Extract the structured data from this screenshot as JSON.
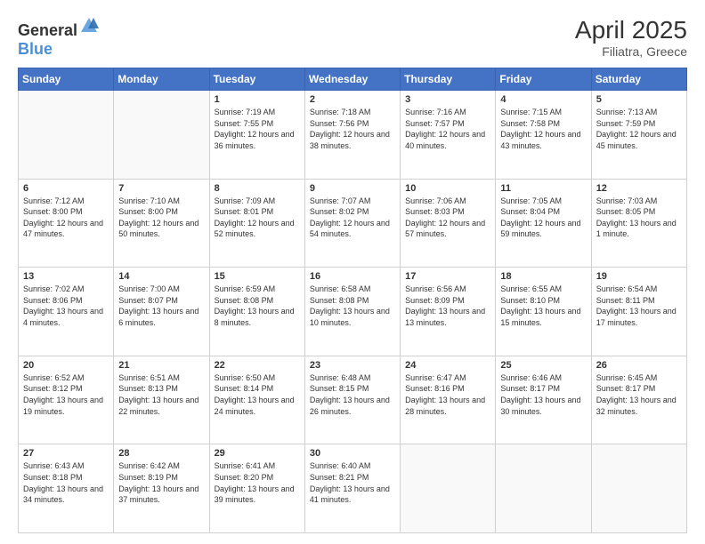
{
  "header": {
    "logo_general": "General",
    "logo_blue": "Blue",
    "title": "April 2025",
    "subtitle": "Filiatra, Greece"
  },
  "weekdays": [
    "Sunday",
    "Monday",
    "Tuesday",
    "Wednesday",
    "Thursday",
    "Friday",
    "Saturday"
  ],
  "weeks": [
    [
      {
        "day": "",
        "info": ""
      },
      {
        "day": "",
        "info": ""
      },
      {
        "day": "1",
        "info": "Sunrise: 7:19 AM\nSunset: 7:55 PM\nDaylight: 12 hours and 36 minutes."
      },
      {
        "day": "2",
        "info": "Sunrise: 7:18 AM\nSunset: 7:56 PM\nDaylight: 12 hours and 38 minutes."
      },
      {
        "day": "3",
        "info": "Sunrise: 7:16 AM\nSunset: 7:57 PM\nDaylight: 12 hours and 40 minutes."
      },
      {
        "day": "4",
        "info": "Sunrise: 7:15 AM\nSunset: 7:58 PM\nDaylight: 12 hours and 43 minutes."
      },
      {
        "day": "5",
        "info": "Sunrise: 7:13 AM\nSunset: 7:59 PM\nDaylight: 12 hours and 45 minutes."
      }
    ],
    [
      {
        "day": "6",
        "info": "Sunrise: 7:12 AM\nSunset: 8:00 PM\nDaylight: 12 hours and 47 minutes."
      },
      {
        "day": "7",
        "info": "Sunrise: 7:10 AM\nSunset: 8:00 PM\nDaylight: 12 hours and 50 minutes."
      },
      {
        "day": "8",
        "info": "Sunrise: 7:09 AM\nSunset: 8:01 PM\nDaylight: 12 hours and 52 minutes."
      },
      {
        "day": "9",
        "info": "Sunrise: 7:07 AM\nSunset: 8:02 PM\nDaylight: 12 hours and 54 minutes."
      },
      {
        "day": "10",
        "info": "Sunrise: 7:06 AM\nSunset: 8:03 PM\nDaylight: 12 hours and 57 minutes."
      },
      {
        "day": "11",
        "info": "Sunrise: 7:05 AM\nSunset: 8:04 PM\nDaylight: 12 hours and 59 minutes."
      },
      {
        "day": "12",
        "info": "Sunrise: 7:03 AM\nSunset: 8:05 PM\nDaylight: 13 hours and 1 minute."
      }
    ],
    [
      {
        "day": "13",
        "info": "Sunrise: 7:02 AM\nSunset: 8:06 PM\nDaylight: 13 hours and 4 minutes."
      },
      {
        "day": "14",
        "info": "Sunrise: 7:00 AM\nSunset: 8:07 PM\nDaylight: 13 hours and 6 minutes."
      },
      {
        "day": "15",
        "info": "Sunrise: 6:59 AM\nSunset: 8:08 PM\nDaylight: 13 hours and 8 minutes."
      },
      {
        "day": "16",
        "info": "Sunrise: 6:58 AM\nSunset: 8:08 PM\nDaylight: 13 hours and 10 minutes."
      },
      {
        "day": "17",
        "info": "Sunrise: 6:56 AM\nSunset: 8:09 PM\nDaylight: 13 hours and 13 minutes."
      },
      {
        "day": "18",
        "info": "Sunrise: 6:55 AM\nSunset: 8:10 PM\nDaylight: 13 hours and 15 minutes."
      },
      {
        "day": "19",
        "info": "Sunrise: 6:54 AM\nSunset: 8:11 PM\nDaylight: 13 hours and 17 minutes."
      }
    ],
    [
      {
        "day": "20",
        "info": "Sunrise: 6:52 AM\nSunset: 8:12 PM\nDaylight: 13 hours and 19 minutes."
      },
      {
        "day": "21",
        "info": "Sunrise: 6:51 AM\nSunset: 8:13 PM\nDaylight: 13 hours and 22 minutes."
      },
      {
        "day": "22",
        "info": "Sunrise: 6:50 AM\nSunset: 8:14 PM\nDaylight: 13 hours and 24 minutes."
      },
      {
        "day": "23",
        "info": "Sunrise: 6:48 AM\nSunset: 8:15 PM\nDaylight: 13 hours and 26 minutes."
      },
      {
        "day": "24",
        "info": "Sunrise: 6:47 AM\nSunset: 8:16 PM\nDaylight: 13 hours and 28 minutes."
      },
      {
        "day": "25",
        "info": "Sunrise: 6:46 AM\nSunset: 8:17 PM\nDaylight: 13 hours and 30 minutes."
      },
      {
        "day": "26",
        "info": "Sunrise: 6:45 AM\nSunset: 8:17 PM\nDaylight: 13 hours and 32 minutes."
      }
    ],
    [
      {
        "day": "27",
        "info": "Sunrise: 6:43 AM\nSunset: 8:18 PM\nDaylight: 13 hours and 34 minutes."
      },
      {
        "day": "28",
        "info": "Sunrise: 6:42 AM\nSunset: 8:19 PM\nDaylight: 13 hours and 37 minutes."
      },
      {
        "day": "29",
        "info": "Sunrise: 6:41 AM\nSunset: 8:20 PM\nDaylight: 13 hours and 39 minutes."
      },
      {
        "day": "30",
        "info": "Sunrise: 6:40 AM\nSunset: 8:21 PM\nDaylight: 13 hours and 41 minutes."
      },
      {
        "day": "",
        "info": ""
      },
      {
        "day": "",
        "info": ""
      },
      {
        "day": "",
        "info": ""
      }
    ]
  ]
}
